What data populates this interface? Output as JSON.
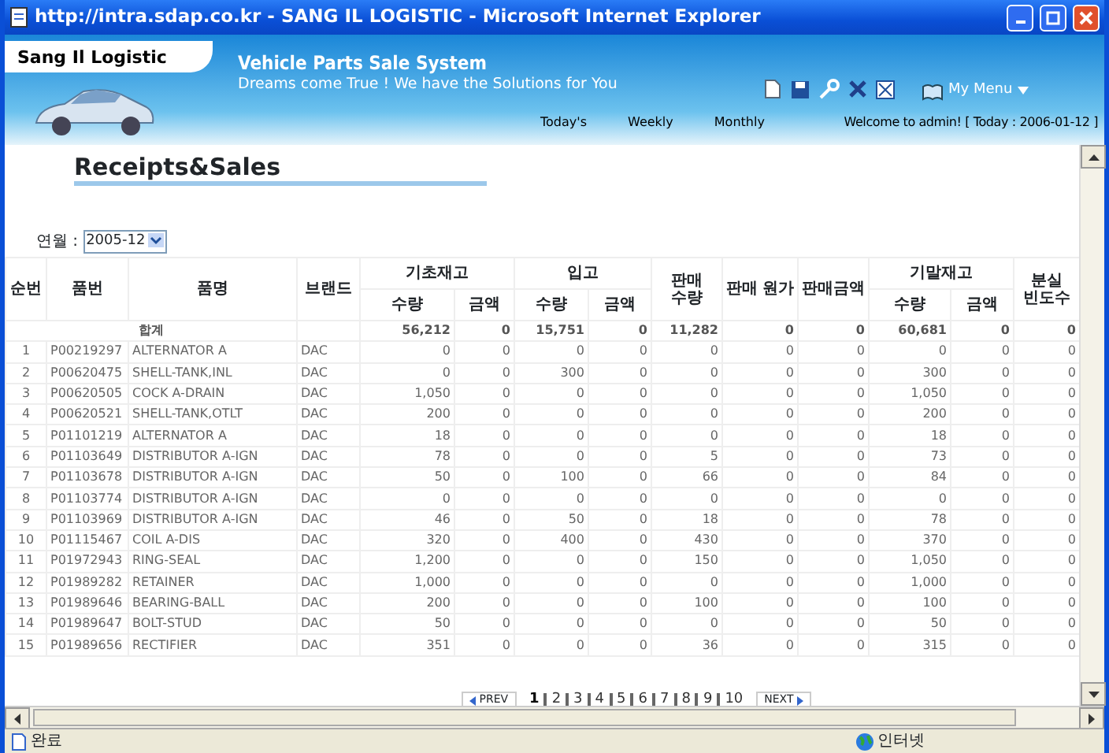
{
  "window": {
    "title": "http://intra.sdap.co.kr - SANG IL LOGISTIC - Microsoft Internet Explorer"
  },
  "header": {
    "logo_text": "Sang Il Logistic",
    "system_title": "Vehicle Parts Sale System",
    "slogan": "Dreams come True ! We have the Solutions for You",
    "my_menu": "My Menu",
    "nav": [
      "Today's",
      "Weekly",
      "Monthly"
    ],
    "welcome": "Welcome to admin! [ Today : 2006-01-12 ]"
  },
  "page_title": "Receipts&Sales",
  "filter": {
    "label": "연월 :",
    "value": "2005-12"
  },
  "table": {
    "columns": [
      {
        "label": "순번"
      },
      {
        "label": "품번"
      },
      {
        "label": "품명"
      },
      {
        "label": "브랜드"
      },
      {
        "label": "기초재고",
        "sub": [
          "수량",
          "금액"
        ]
      },
      {
        "label": "입고",
        "sub": [
          "수량",
          "금액"
        ]
      },
      {
        "label": "판매 수량"
      },
      {
        "label": "판매 원가"
      },
      {
        "label": "판매금액"
      },
      {
        "label": "기말재고",
        "sub": [
          "수량",
          "금액"
        ]
      },
      {
        "label": "분실 빈도수"
      }
    ],
    "total_row": {
      "label": "합계",
      "values": [
        "56,212",
        "0",
        "15,751",
        "0",
        "11,282",
        "0",
        "0",
        "60,681",
        "0",
        "0"
      ]
    },
    "rows": [
      {
        "no": "1",
        "part_no": "P00219297",
        "name": "ALTERNATOR A",
        "brand": "DAC",
        "values": [
          "0",
          "0",
          "0",
          "0",
          "0",
          "0",
          "0",
          "0",
          "0",
          "0"
        ]
      },
      {
        "no": "2",
        "part_no": "P00620475",
        "name": "SHELL-TANK,INL",
        "brand": "DAC",
        "values": [
          "0",
          "0",
          "300",
          "0",
          "0",
          "0",
          "0",
          "300",
          "0",
          "0"
        ]
      },
      {
        "no": "3",
        "part_no": "P00620505",
        "name": "COCK A-DRAIN",
        "brand": "DAC",
        "values": [
          "1,050",
          "0",
          "0",
          "0",
          "0",
          "0",
          "0",
          "1,050",
          "0",
          "0"
        ]
      },
      {
        "no": "4",
        "part_no": "P00620521",
        "name": "SHELL-TANK,OTLT",
        "brand": "DAC",
        "values": [
          "200",
          "0",
          "0",
          "0",
          "0",
          "0",
          "0",
          "200",
          "0",
          "0"
        ]
      },
      {
        "no": "5",
        "part_no": "P01101219",
        "name": "ALTERNATOR A",
        "brand": "DAC",
        "values": [
          "18",
          "0",
          "0",
          "0",
          "0",
          "0",
          "0",
          "18",
          "0",
          "0"
        ]
      },
      {
        "no": "6",
        "part_no": "P01103649",
        "name": "DISTRIBUTOR A-IGN",
        "brand": "DAC",
        "values": [
          "78",
          "0",
          "0",
          "0",
          "5",
          "0",
          "0",
          "73",
          "0",
          "0"
        ]
      },
      {
        "no": "7",
        "part_no": "P01103678",
        "name": "DISTRIBUTOR A-IGN",
        "brand": "DAC",
        "values": [
          "50",
          "0",
          "100",
          "0",
          "66",
          "0",
          "0",
          "84",
          "0",
          "0"
        ]
      },
      {
        "no": "8",
        "part_no": "P01103774",
        "name": "DISTRIBUTOR A-IGN",
        "brand": "DAC",
        "values": [
          "0",
          "0",
          "0",
          "0",
          "0",
          "0",
          "0",
          "0",
          "0",
          "0"
        ]
      },
      {
        "no": "9",
        "part_no": "P01103969",
        "name": "DISTRIBUTOR A-IGN",
        "brand": "DAC",
        "values": [
          "46",
          "0",
          "50",
          "0",
          "18",
          "0",
          "0",
          "78",
          "0",
          "0"
        ]
      },
      {
        "no": "10",
        "part_no": "P01115467",
        "name": "COIL A-DIS",
        "brand": "DAC",
        "values": [
          "320",
          "0",
          "400",
          "0",
          "430",
          "0",
          "0",
          "370",
          "0",
          "0"
        ]
      },
      {
        "no": "11",
        "part_no": "P01972943",
        "name": "RING-SEAL",
        "brand": "DAC",
        "values": [
          "1,200",
          "0",
          "0",
          "0",
          "150",
          "0",
          "0",
          "1,050",
          "0",
          "0"
        ]
      },
      {
        "no": "12",
        "part_no": "P01989282",
        "name": "RETAINER",
        "brand": "DAC",
        "values": [
          "1,000",
          "0",
          "0",
          "0",
          "0",
          "0",
          "0",
          "1,000",
          "0",
          "0"
        ]
      },
      {
        "no": "13",
        "part_no": "P01989646",
        "name": "BEARING-BALL",
        "brand": "DAC",
        "values": [
          "200",
          "0",
          "0",
          "0",
          "100",
          "0",
          "0",
          "100",
          "0",
          "0"
        ]
      },
      {
        "no": "14",
        "part_no": "P01989647",
        "name": "BOLT-STUD",
        "brand": "DAC",
        "values": [
          "50",
          "0",
          "0",
          "0",
          "0",
          "0",
          "0",
          "50",
          "0",
          "0"
        ]
      },
      {
        "no": "15",
        "part_no": "P01989656",
        "name": "RECTIFIER",
        "brand": "DAC",
        "values": [
          "351",
          "0",
          "0",
          "0",
          "36",
          "0",
          "0",
          "315",
          "0",
          "0"
        ]
      }
    ]
  },
  "pagination": {
    "prev": "PREV",
    "next": "NEXT",
    "pages": [
      {
        "label": "1",
        "selected": true
      },
      {
        "label": "2",
        "selected": false
      },
      {
        "label": "3",
        "selected": false
      },
      {
        "label": "4",
        "selected": false
      },
      {
        "label": "5",
        "selected": false
      },
      {
        "label": "6",
        "selected": false
      },
      {
        "label": "7",
        "selected": false
      },
      {
        "label": "8",
        "selected": false
      },
      {
        "label": "9",
        "selected": false
      },
      {
        "label": "10",
        "selected": false
      }
    ]
  },
  "status_bar": {
    "status": "완료",
    "zone": "인터넷"
  }
}
